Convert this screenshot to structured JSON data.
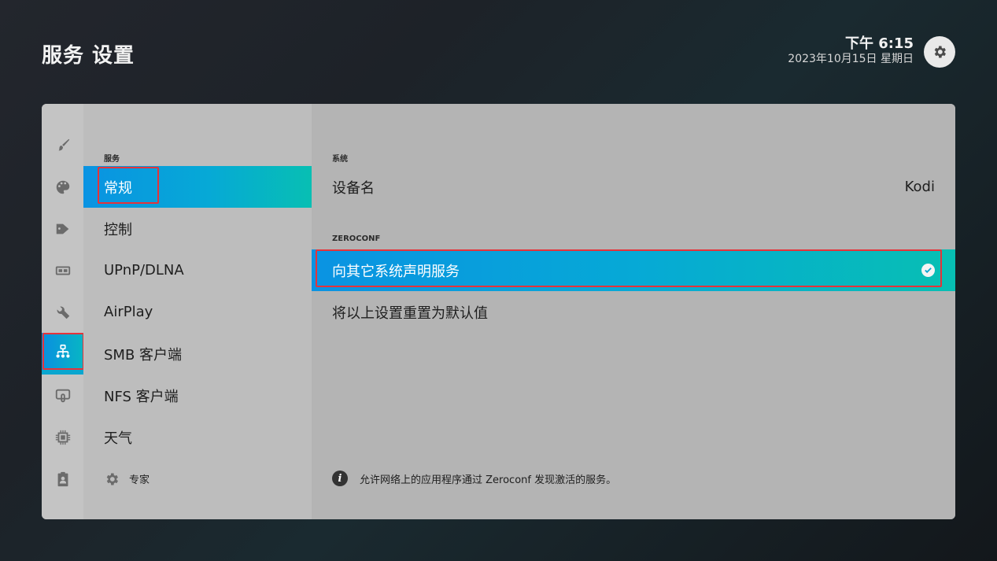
{
  "header": {
    "title": "服务 设置",
    "time": "下午 6:15",
    "date": "2023年10月15日 星期日"
  },
  "rail": {
    "icons": [
      "brush-icon",
      "palette-icon",
      "tags-icon",
      "media-icon",
      "wrench-icon",
      "network-icon",
      "remote-icon",
      "chip-icon",
      "clipboard-icon"
    ],
    "active_index": 5
  },
  "nav": {
    "section_label": "服务",
    "items": [
      "常规",
      "控制",
      "UPnP/DLNA",
      "AirPlay",
      "SMB 客户端",
      "NFS 客户端",
      "天气"
    ],
    "expert_label": "专家",
    "active_index": 0
  },
  "content": {
    "system_label": "系统",
    "device_name_label": "设备名",
    "device_name_value": "Kodi",
    "zeroconf_label": "ZEROCONF",
    "announce_label": "向其它系统声明服务",
    "announce_enabled": true,
    "reset_label": "将以上设置重置为默认值",
    "info_text": "允许网络上的应用程序通过 Zeroconf 发现激活的服务。"
  },
  "colors": {
    "accent_start": "#0a93e2",
    "accent_end": "#07bfb3",
    "highlight_border": "#e5333a"
  }
}
